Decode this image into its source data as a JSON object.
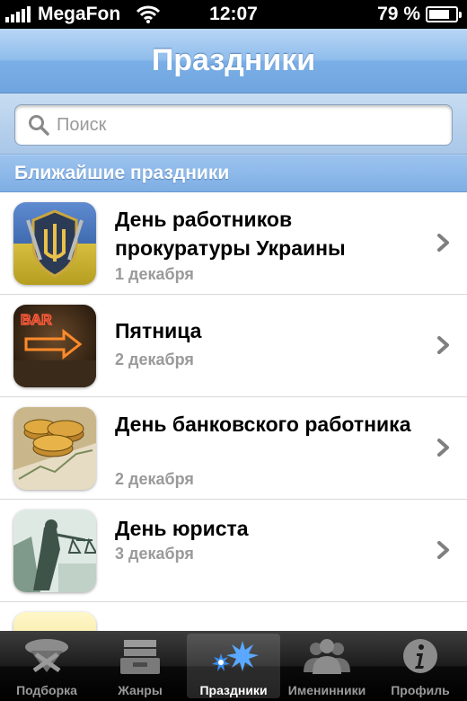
{
  "status_bar": {
    "carrier": "MegaFon",
    "time": "12:07",
    "battery_percent_label": "79 %",
    "battery_level": 0.79
  },
  "nav": {
    "title": "Праздники"
  },
  "search": {
    "placeholder": "Поиск",
    "value": ""
  },
  "section": {
    "header": "Ближайшие праздники"
  },
  "holidays": [
    {
      "title": "День работников прокуратуры Украины",
      "date": "1 декабря",
      "icon": "ukraine-prosecutor-emblem-icon"
    },
    {
      "title": "Пятница",
      "date": "2 декабря",
      "icon": "bar-neon-sign-icon"
    },
    {
      "title": "День банковского работника",
      "date": "2 декабря",
      "icon": "coins-icon"
    },
    {
      "title": "День юриста",
      "date": "3 декабря",
      "icon": "lady-justice-icon"
    }
  ],
  "tabs": [
    {
      "label": "Подборка",
      "icon": "selection-icon",
      "active": false
    },
    {
      "label": "Жанры",
      "icon": "genres-box-icon",
      "active": false
    },
    {
      "label": "Праздники",
      "icon": "fireworks-icon",
      "active": true
    },
    {
      "label": "Именинники",
      "icon": "people-icon",
      "active": false
    },
    {
      "label": "Профиль",
      "icon": "info-icon",
      "active": false
    }
  ],
  "colors": {
    "nav_gradient_top": "#b8d6f5",
    "nav_gradient_bottom": "#6fa5df",
    "section_header": "#8ab8ea",
    "date_text": "#9a9a9a",
    "tab_active": "#ffffff",
    "tab_inactive": "#9a9a9a"
  }
}
